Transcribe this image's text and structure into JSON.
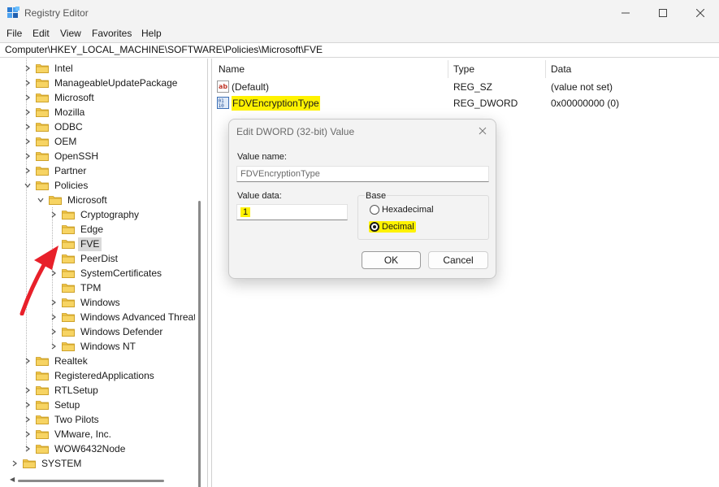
{
  "window": {
    "title": "Registry Editor",
    "icon": "registry-editor-icon"
  },
  "menu": [
    "File",
    "Edit",
    "View",
    "Favorites",
    "Help"
  ],
  "address": "Computer\\HKEY_LOCAL_MACHINE\\SOFTWARE\\Policies\\Microsoft\\FVE",
  "tree": {
    "items": [
      {
        "label": "Intel",
        "expander": "collapsed"
      },
      {
        "label": "ManageableUpdatePackage",
        "expander": "collapsed"
      },
      {
        "label": "Microsoft",
        "expander": "collapsed"
      },
      {
        "label": "Mozilla",
        "expander": "collapsed"
      },
      {
        "label": "ODBC",
        "expander": "collapsed"
      },
      {
        "label": "OEM",
        "expander": "collapsed"
      },
      {
        "label": "OpenSSH",
        "expander": "collapsed"
      },
      {
        "label": "Partner",
        "expander": "collapsed"
      },
      {
        "label": "Policies",
        "expander": "expanded"
      },
      {
        "label": "Microsoft",
        "expander": "expanded"
      },
      {
        "label": "Cryptography",
        "expander": "collapsed"
      },
      {
        "label": "Edge",
        "expander": "none"
      },
      {
        "label": "FVE",
        "expander": "none",
        "selected": true
      },
      {
        "label": "PeerDist",
        "expander": "none"
      },
      {
        "label": "SystemCertificates",
        "expander": "collapsed"
      },
      {
        "label": "TPM",
        "expander": "none"
      },
      {
        "label": "Windows",
        "expander": "collapsed"
      },
      {
        "label": "Windows Advanced Threat",
        "expander": "collapsed"
      },
      {
        "label": "Windows Defender",
        "expander": "collapsed"
      },
      {
        "label": "Windows NT",
        "expander": "collapsed"
      },
      {
        "label": "Realtek",
        "expander": "collapsed"
      },
      {
        "label": "RegisteredApplications",
        "expander": "none"
      },
      {
        "label": "RTLSetup",
        "expander": "collapsed"
      },
      {
        "label": "Setup",
        "expander": "collapsed"
      },
      {
        "label": "Two Pilots",
        "expander": "collapsed"
      },
      {
        "label": "VMware, Inc.",
        "expander": "collapsed"
      },
      {
        "label": "WOW6432Node",
        "expander": "collapsed"
      },
      {
        "label": "SYSTEM",
        "expander": "collapsed"
      }
    ]
  },
  "values_table": {
    "columns": [
      "Name",
      "Type",
      "Data"
    ],
    "rows": [
      {
        "name": "(Default)",
        "type": "REG_SZ",
        "data": "(value not set)",
        "icon": "string-value-icon"
      },
      {
        "name": "FDVEncryptionType",
        "type": "REG_DWORD",
        "data": "0x00000000 (0)",
        "icon": "binary-value-icon",
        "highlighted": true
      }
    ]
  },
  "dialog": {
    "title": "Edit DWORD (32-bit) Value",
    "value_name_label": "Value name:",
    "value_name": "FDVEncryptionType",
    "value_data_label": "Value data:",
    "value_data": "1",
    "base_label": "Base",
    "base_options": [
      {
        "label": "Hexadecimal",
        "selected": false
      },
      {
        "label": "Decimal",
        "selected": true
      }
    ],
    "ok_label": "OK",
    "cancel_label": "Cancel"
  },
  "colors": {
    "highlight": "#fff200",
    "annotation_arrow": "#e8202a",
    "folder": "#f2c84b"
  }
}
